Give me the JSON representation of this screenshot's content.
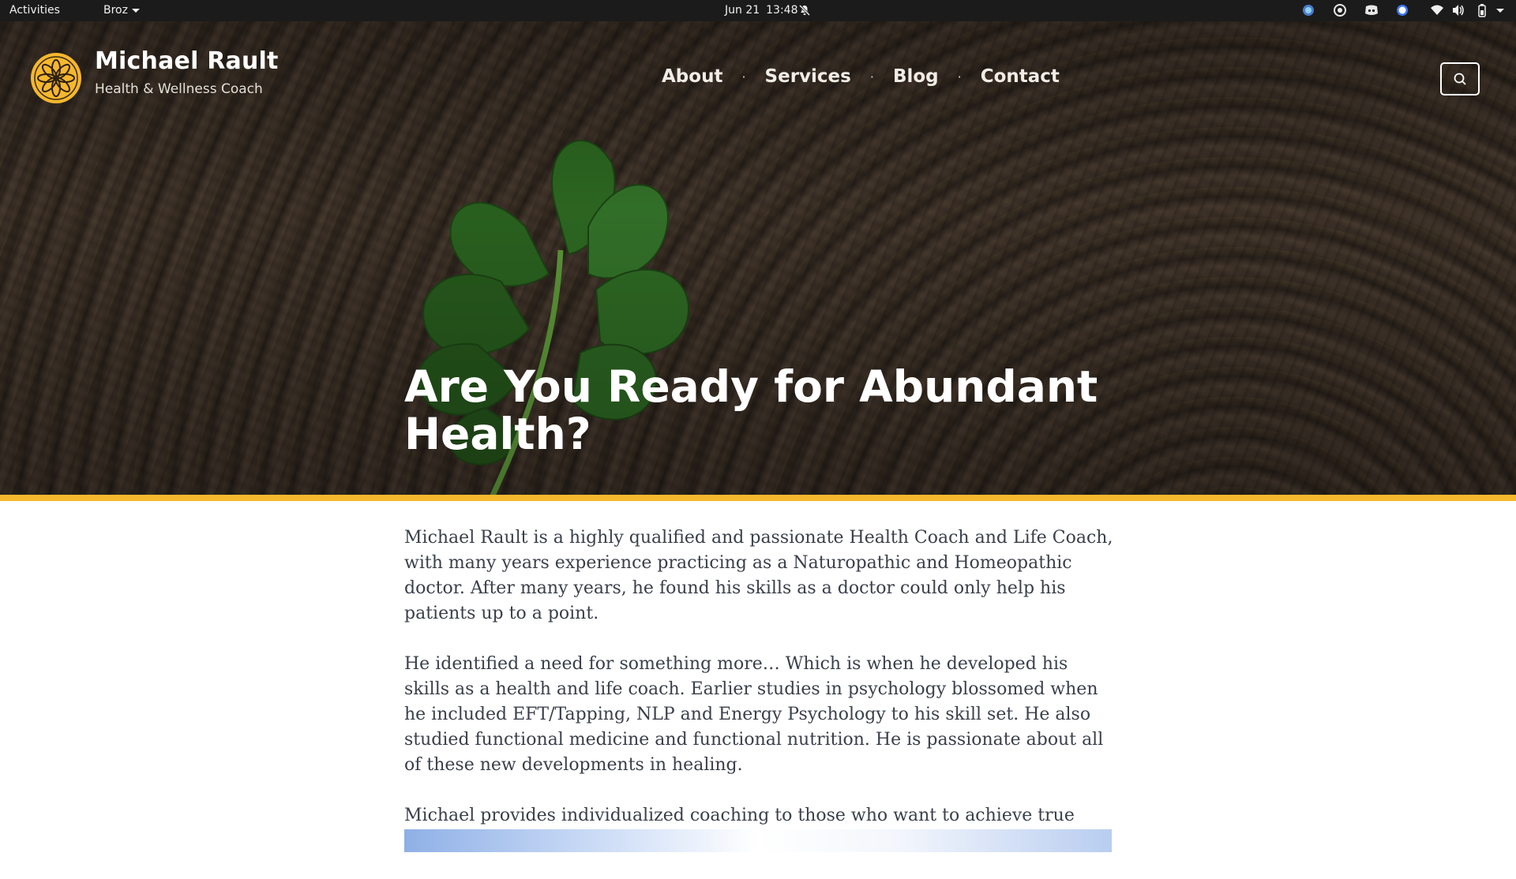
{
  "system_bar": {
    "activities": "Activities",
    "app_menu": "Broz",
    "date": "Jun 21",
    "time": "13:48"
  },
  "site": {
    "name": "Michael Rault",
    "tagline": "Health & Wellness Coach",
    "accent_color": "#f5b72d"
  },
  "nav": {
    "items": [
      {
        "label": "About"
      },
      {
        "label": "Services"
      },
      {
        "label": "Blog"
      },
      {
        "label": "Contact"
      }
    ],
    "separator": "·"
  },
  "hero": {
    "title": "Are You Ready for Abundant Health?"
  },
  "content": {
    "paragraphs": [
      "Michael Rault is a highly qualified and passionate Health Coach and Life Coach, with many years experience practicing as a Naturopathic and Homeopathic doctor. After many years, he found his skills as a doctor could only help his patients up to a point.",
      "He identified a need for something more… Which is when he developed his skills as a health and life coach. Earlier studies in psychology blossomed when he included EFT/Tapping, NLP and Energy Psychology to his skill set. He also studied functional medicine and functional nutrition. He is passionate about all of these new developments in healing.",
      "Michael provides individualized coaching to those who want to achieve true health and happiness."
    ]
  },
  "icons": {
    "tray": [
      "tray-app-icon",
      "chrome-icon",
      "discord-icon",
      "signal-icon",
      "wifi-icon",
      "volume-icon",
      "battery-icon",
      "power-menu-icon"
    ]
  }
}
